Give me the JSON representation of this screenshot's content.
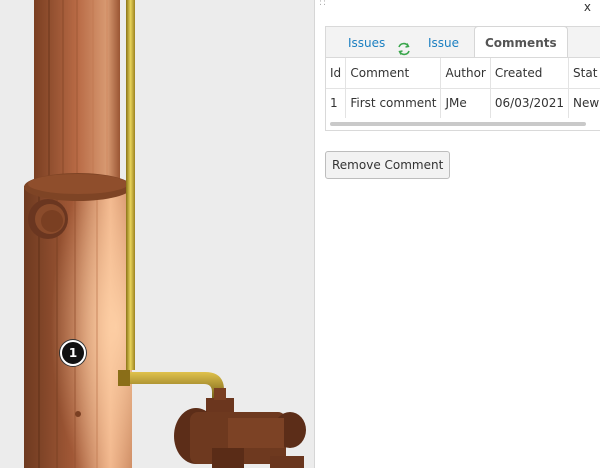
{
  "viewport": {
    "marker_label": "1"
  },
  "panel": {
    "close_label": "x",
    "grip": "::",
    "tabs": {
      "issues": "Issues",
      "issue": "Issue",
      "comments": "Comments"
    },
    "table": {
      "headers": [
        "Id",
        "Comment",
        "Author",
        "Created",
        "Stat"
      ],
      "rows": [
        [
          "1",
          "First comment",
          "JMe",
          "06/03/2021",
          "New"
        ]
      ]
    },
    "remove_button": "Remove Comment"
  },
  "colors": {
    "tab_link": "#1b7fc1",
    "pipe": "#c8a83a",
    "column": "#b5663e"
  },
  "icons": {
    "sync": "sync-icon"
  }
}
